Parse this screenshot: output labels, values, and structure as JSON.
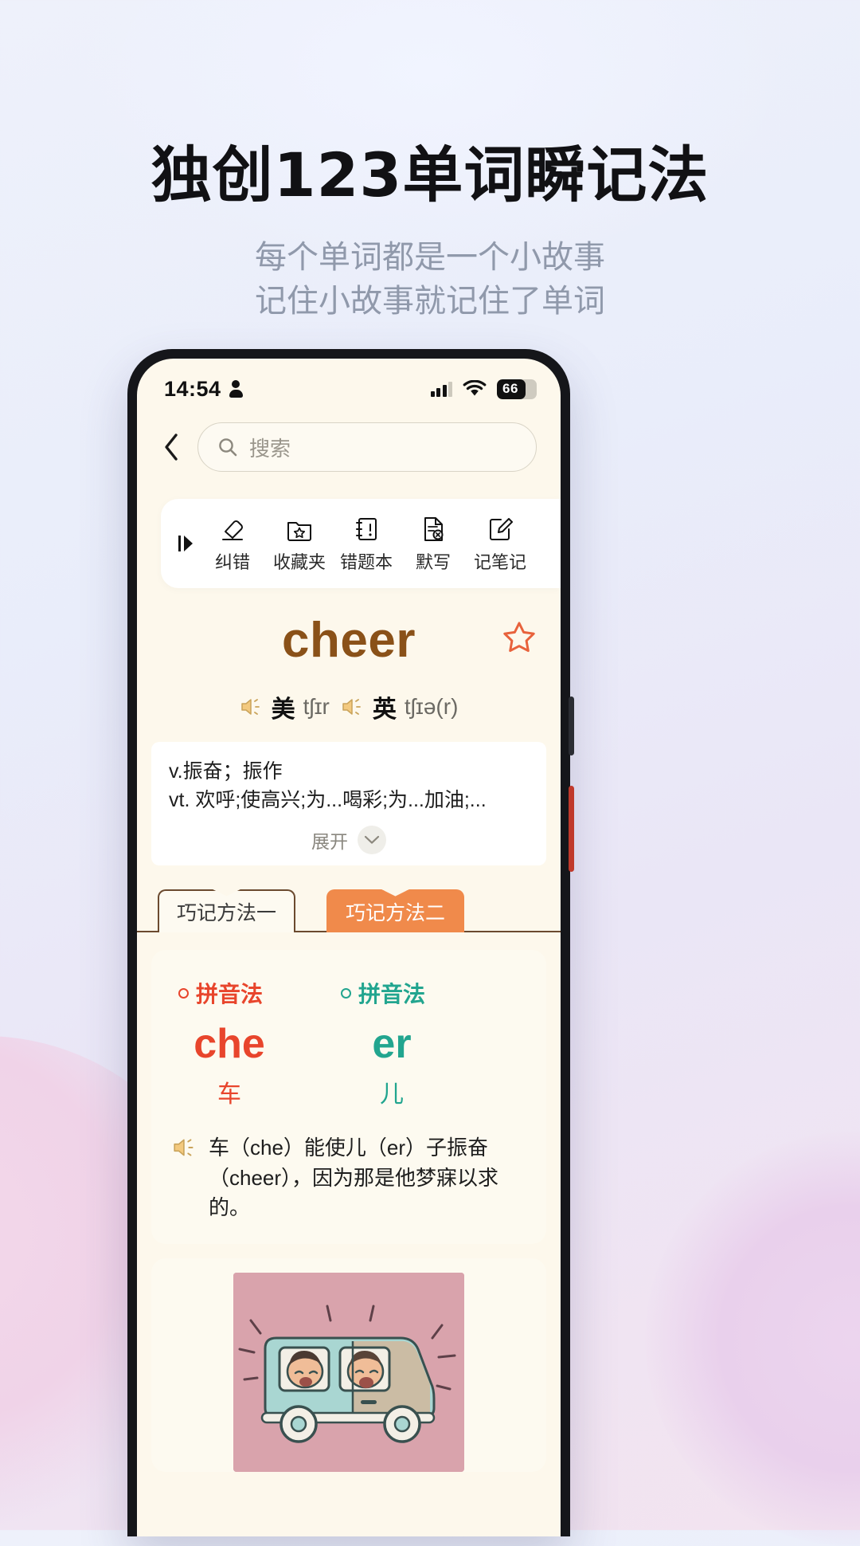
{
  "promo": {
    "title": "独创123单词瞬记法",
    "subtitle_line1": "每个单词都是一个小故事",
    "subtitle_line2": "记住小故事就记住了单词"
  },
  "status_bar": {
    "time": "14:54",
    "person_icon": "person-icon",
    "signal_icon": "cellular-signal-icon",
    "wifi_icon": "wifi-icon",
    "battery_level": "66"
  },
  "search": {
    "back_icon": "chevron-left-icon",
    "search_icon": "search-icon",
    "placeholder": "搜索",
    "value": ""
  },
  "toolbar": {
    "arrow_icon": "play-arrow-icon",
    "items": [
      {
        "label": "纠错",
        "icon": "eraser-icon"
      },
      {
        "label": "收藏夹",
        "icon": "folder-star-icon"
      },
      {
        "label": "错题本",
        "icon": "notebook-icon"
      },
      {
        "label": "默写",
        "icon": "document-x-icon"
      },
      {
        "label": "记笔记",
        "icon": "note-edit-icon"
      }
    ]
  },
  "word_entry": {
    "word": "cheer",
    "star_icon": "star-outline-icon",
    "pronunciations": [
      {
        "speaker_icon": "speaker-icon",
        "lang": "美",
        "ipa": "tʃɪr"
      },
      {
        "speaker_icon": "speaker-icon",
        "lang": "英",
        "ipa": "tʃɪə(r)"
      }
    ],
    "definitions": [
      "v.振奋；振作",
      "vt. 欢呼;使高兴;为...喝彩;为...加油;..."
    ],
    "expand_label": "展开",
    "expand_icon": "chevron-down-icon"
  },
  "tabs": [
    {
      "label": "巧记方法一",
      "active": true
    },
    {
      "label": "巧记方法二",
      "active": false
    }
  ],
  "mnemonic": {
    "parts": [
      {
        "method_label": "拼音法",
        "syllable": "che",
        "chinese": "车",
        "color": "#e8452c"
      },
      {
        "method_label": "拼音法",
        "syllable": "er",
        "chinese": "儿",
        "color": "#22a58f"
      }
    ],
    "story_speaker_icon": "speaker-icon",
    "story": "车（che）能使儿（er）子振奋（cheer），因为那是他梦寐以求的。"
  },
  "illustration": {
    "alt": "卡通插画：车里的男孩欢呼",
    "icon": "illustration-car-boys"
  },
  "colors": {
    "screen_bg": "#fdf8ec",
    "word_brown": "#8a5118",
    "tab_orange": "#f08a4b",
    "red": "#e8452c",
    "teal": "#22a58f"
  }
}
